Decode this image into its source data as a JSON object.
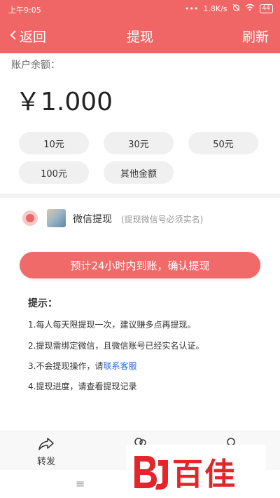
{
  "status_bar": {
    "time": "上午9:05",
    "dots": "•••",
    "speed": "1.8K/s",
    "battery": "44"
  },
  "nav": {
    "back_label": "返回",
    "title": "提现",
    "refresh_label": "刷新"
  },
  "balance": {
    "label": "账户余额：",
    "amount": "￥1.000"
  },
  "amount_options": [
    "10元",
    "30元",
    "50元",
    "100元",
    "其他金额"
  ],
  "method": {
    "label": "微信提现",
    "note": "(提现微信号必须实名)"
  },
  "confirm_button": "预计24小时内到账，确认提现",
  "tips": {
    "title": "提示：",
    "item1": "1.每人每天限提现一次，建议赚多点再提现。",
    "item2": "2.提现需绑定微信，且微信账号已经实名认证。",
    "item3_prefix": "3.不会提现操作，请",
    "item3_link": "联系客服",
    "item4": "4.提现进度，请查看提现记录"
  },
  "bottom_nav": {
    "share_label": "转发"
  },
  "system_nav": {
    "menu": "≡"
  },
  "watermark": {
    "text": "百佳"
  },
  "colors": {
    "accent": "#f06666",
    "link": "#2f6fd6",
    "watermark": "#e3262c"
  }
}
